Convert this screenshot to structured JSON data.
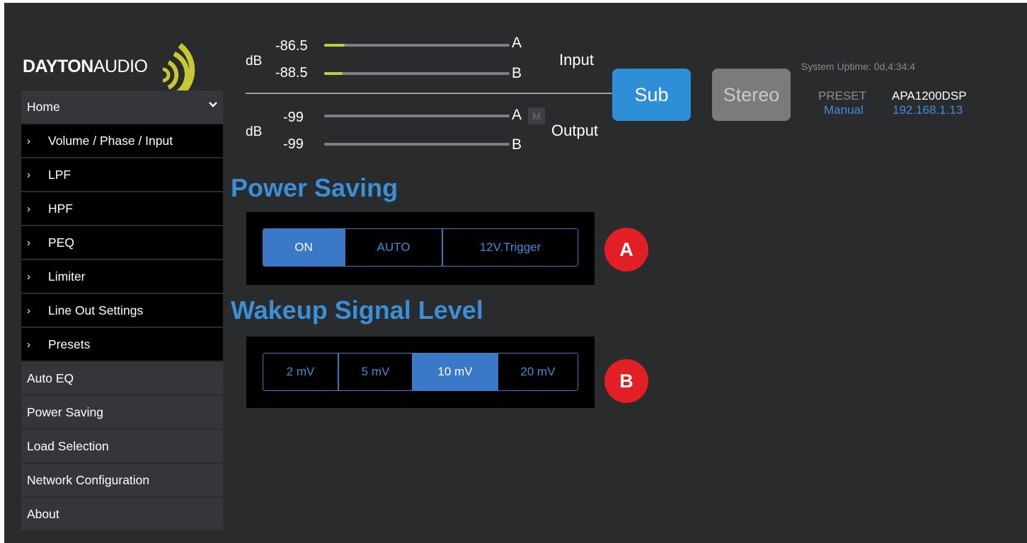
{
  "logo": {
    "bold": "DAYTON",
    "thin": "AUDIO"
  },
  "sidebar": {
    "home": "Home",
    "sub_items": [
      "Volume / Phase / Input",
      "LPF",
      "HPF",
      "PEQ",
      "Limiter",
      "Line Out Settings",
      "Presets"
    ],
    "main_items": [
      "Auto EQ",
      "Power Saving",
      "Load Selection",
      "Network Configuration",
      "About"
    ]
  },
  "meters": {
    "db_unit": "dB",
    "input_label": "Input",
    "output_label": "Output",
    "input": [
      {
        "channel": "A",
        "value": "-86.5",
        "level": 0.11
      },
      {
        "channel": "B",
        "value": "-88.5",
        "level": 0.1
      }
    ],
    "output": [
      {
        "channel": "A",
        "value": "-99",
        "level": 0
      },
      {
        "channel": "B",
        "value": "-99",
        "level": 0
      }
    ],
    "mute_label": "M"
  },
  "mode_buttons": {
    "sub": "Sub",
    "stereo": "Stereo",
    "active": "Sub"
  },
  "status": {
    "uptime": "System Uptime: 0d,4:34:4",
    "preset_label": "PRESET",
    "model": "APA1200DSP",
    "preset_mode": "Manual",
    "ip": "192.168.1.13"
  },
  "power_saving": {
    "heading": "Power Saving",
    "options": [
      "ON",
      "AUTO",
      "12V.Trigger"
    ],
    "selected": "ON",
    "badge": "A"
  },
  "wakeup": {
    "heading": "Wakeup Signal Level",
    "options": [
      "2 mV",
      "5 mV",
      "10 mV",
      "20 mV"
    ],
    "selected": "10 mV",
    "badge": "B"
  },
  "colors": {
    "background": "#2a2b2d",
    "accent_blue": "#3b8fd6",
    "meter_green": "#b3d336",
    "badge_red": "#e31f26"
  }
}
